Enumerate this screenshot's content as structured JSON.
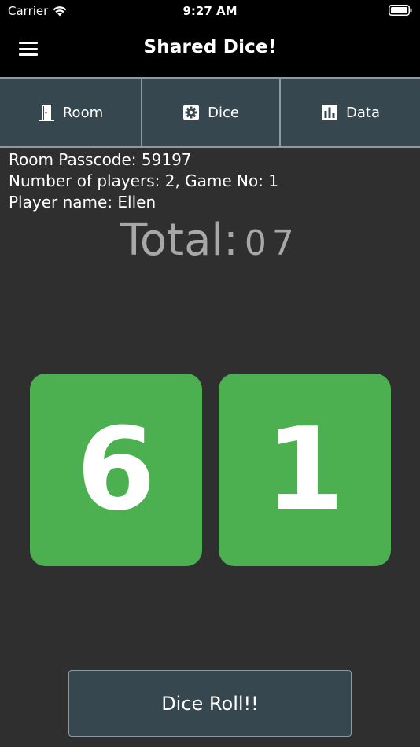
{
  "status_bar": {
    "carrier": "Carrier",
    "time": "9:27 AM"
  },
  "nav": {
    "title": "Shared Dice!",
    "menu_icon": "hamburger-menu-icon"
  },
  "tabs": [
    {
      "label": "Room",
      "icon": "door-icon"
    },
    {
      "label": "Dice",
      "icon": "gear-icon"
    },
    {
      "label": "Data",
      "icon": "bar-chart-icon"
    }
  ],
  "info": {
    "passcode_line": "Room Passcode: 59197",
    "players_line": "Number of players: 2,  Game No: 1",
    "player_line": "Player name: Ellen"
  },
  "total": {
    "label": "Total:",
    "value": "07"
  },
  "dice": {
    "die1": "6",
    "die2": "1",
    "color": "#4caf50"
  },
  "roll_button": {
    "label": "Dice Roll!!"
  },
  "colors": {
    "background": "#2f2f2f",
    "tab_bg": "#37474f",
    "total_text": "#a8a8a8"
  }
}
